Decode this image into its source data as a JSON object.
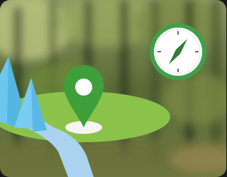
{
  "scene": {
    "palette": {
      "forest_dark": "#2f3d24",
      "forest_mid": "#5f7a3a",
      "forest_light": "#a8b86a",
      "ground": "#8bc34a",
      "pin": "#3f9f3a",
      "pin_shadow": "#f3f3f3",
      "river": "#a9d3ee",
      "mountains": "#5fc0ea",
      "compass_ring": "#3fa04a",
      "compass_face": "#ffffff",
      "compass_needle": "#2e7d32"
    },
    "icons": {
      "location_pin": "map-pin-icon",
      "compass": "compass-icon",
      "mountains": "mountain-icon",
      "river": "river-icon"
    }
  }
}
